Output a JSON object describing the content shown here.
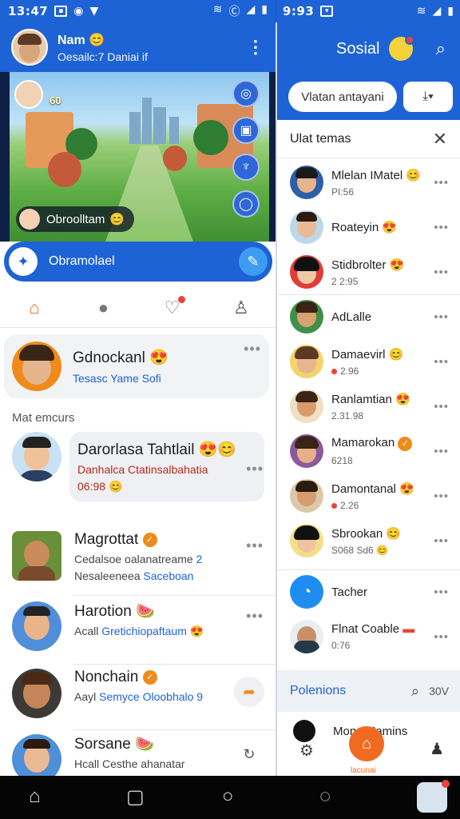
{
  "status_left": {
    "time": "13:47"
  },
  "status_right": {
    "time": "9:93"
  },
  "header": {
    "name": "Nam",
    "subtitle": "Oesailc:7 Daniai if"
  },
  "game": {
    "score": "60",
    "player_label": "Obroolltam"
  },
  "action_bar": {
    "label": "Obramolael"
  },
  "featured": {
    "name": "Gdnockanl",
    "sub": "Tesasc Yame Sofi"
  },
  "section_label": "Mat emcurs",
  "conversations": [
    {
      "name": "Darorlasa Tahtlail",
      "line1": "Danhalca Ctatinsalbahatia",
      "line2": "06:98"
    },
    {
      "name": "Magrottat",
      "line1": "Cedalsoe oalanatreame",
      "line1_num": "2",
      "line2": "Nesaleeneea",
      "line2_link": "Saceboan"
    },
    {
      "name": "Harotion",
      "line1": "Acall",
      "line1_link": "Gretichiopaftaum"
    },
    {
      "name": "Nonchain",
      "line1": "Aayl",
      "line1_link": "Semyce Oloobhalo 9"
    },
    {
      "name": "Sorsane",
      "line1": "Hcall Cesthe ahanatar"
    }
  ],
  "right_panel": {
    "title": "Sosial",
    "input_placeholder": "Vlatan antayani",
    "list_title": "Ulat temas",
    "items": [
      {
        "name": "Mlelan IMatel",
        "sub": "PI:56"
      },
      {
        "name": "Roateyin",
        "sub": ""
      },
      {
        "name": "Stidbrolter",
        "sub": "2 2:95"
      },
      {
        "name": "AdLalle",
        "sub": ""
      },
      {
        "name": "Damaevirl",
        "sub": "2.96"
      },
      {
        "name": "Ranlamtian",
        "sub": "2.31.98"
      },
      {
        "name": "Mamarokan",
        "sub": "6218"
      },
      {
        "name": "Damontanal",
        "sub": "2.26"
      },
      {
        "name": "Sbrookan",
        "sub": "S068 Sd6"
      },
      {
        "name": "Tacher",
        "sub": ""
      },
      {
        "name": "Flnat Coable",
        "sub": "0:76"
      }
    ],
    "footer_label": "Polenions",
    "footer_extra": "30V",
    "bottom_name": "Mons Mamins",
    "bottom_center_label": "lacunai"
  },
  "colors": {
    "primary": "#1d63d6",
    "accent": "#f06a21",
    "alert": "#e8443a"
  }
}
